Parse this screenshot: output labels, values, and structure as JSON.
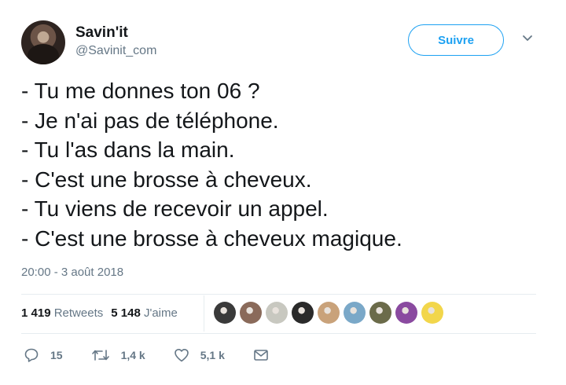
{
  "header": {
    "display_name": "Savin'it",
    "handle": "@Savinit_com",
    "follow_label": "Suivre"
  },
  "tweet": {
    "lines": [
      "- Tu me donnes ton 06 ?",
      "- Je n'ai pas de téléphone.",
      "- Tu l'as dans la main.",
      "- C'est une brosse à cheveux.",
      "- Tu viens de recevoir un appel.",
      "- C'est une brosse à cheveux magique."
    ],
    "timestamp": "20:00 - 3 août 2018"
  },
  "stats": {
    "retweets_count": "1 419",
    "retweets_label": "Retweets",
    "likes_count": "5 148",
    "likes_label": "J'aime"
  },
  "likers": [
    {
      "color": "#3a3a3a"
    },
    {
      "color": "#8a6a5a"
    },
    {
      "color": "#c8c8c0"
    },
    {
      "color": "#2a2a2a"
    },
    {
      "color": "#c9a27a"
    },
    {
      "color": "#7aa8c8"
    },
    {
      "color": "#6b6b4a"
    },
    {
      "color": "#8a4aa0"
    },
    {
      "color": "#f2d64b"
    }
  ],
  "actions": {
    "replies": "15",
    "retweets": "1,4 k",
    "likes": "5,1 k"
  },
  "colors": {
    "accent": "#1da1f2",
    "text": "#14171a",
    "muted": "#657786"
  }
}
